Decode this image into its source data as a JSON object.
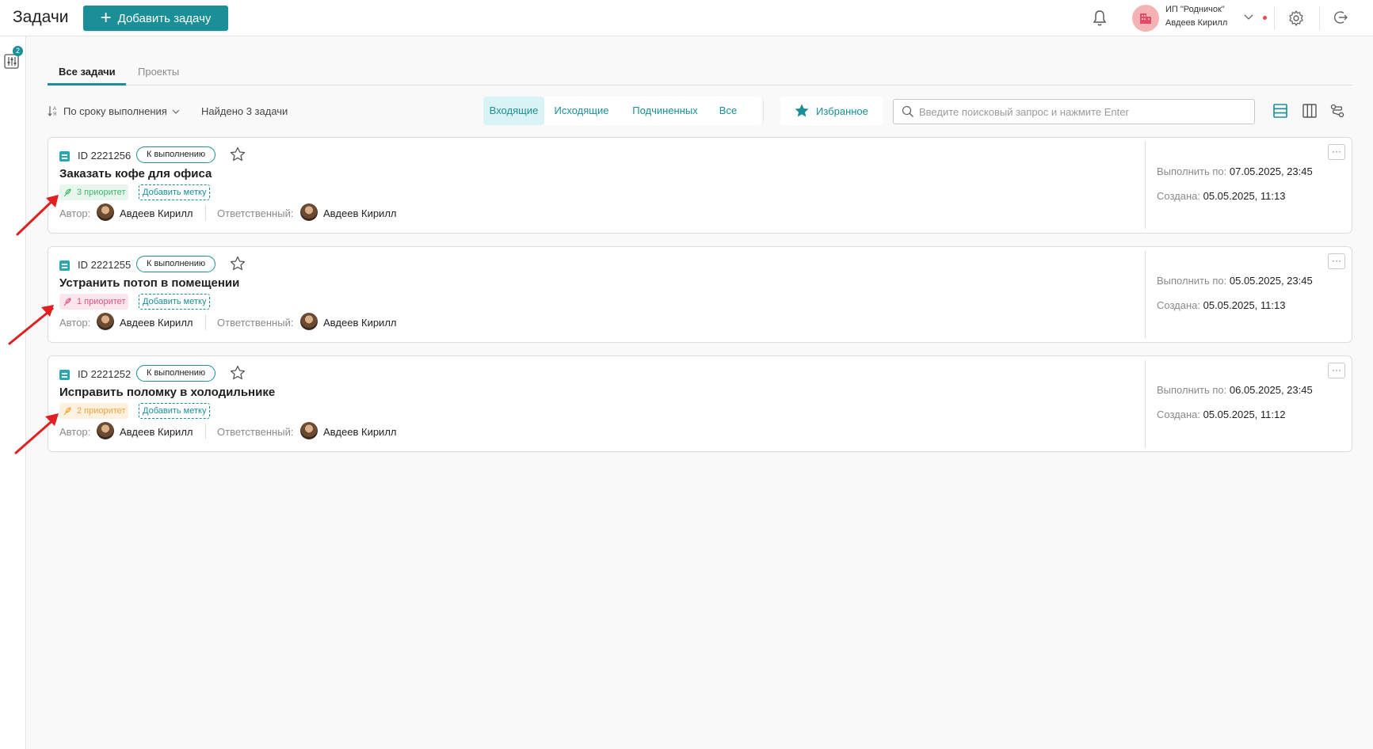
{
  "header": {
    "title": "Задачи",
    "add_task_label": "Добавить задачу",
    "company": "ИП \"Родничок\"",
    "user": "Авдеев Кирилл"
  },
  "rail": {
    "filter_badge": "2"
  },
  "tabs": [
    {
      "label": "Все задачи",
      "active": true
    },
    {
      "label": "Проекты",
      "active": false
    }
  ],
  "toolbar": {
    "sort_label": "По сроку выполнения",
    "found_label": "Найдено 3 задачи",
    "filters": [
      {
        "label": "Входящие",
        "active": true
      },
      {
        "label": "Исходящие",
        "active": false
      },
      {
        "label": "Подчиненных",
        "active": false
      },
      {
        "label": "Все",
        "active": false
      }
    ],
    "favorites_label": "Избранное",
    "search_placeholder": "Введите поисковый запрос и нажмите Enter",
    "search_value": ""
  },
  "labels": {
    "author": "Автор:",
    "assignee": "Ответственный:",
    "due": "Выполнить по:",
    "created": "Создана:",
    "add_tag": "Добавить метку",
    "menu": "···"
  },
  "colors": {
    "accent": "#1a8f97",
    "priority_1": "#e0547b",
    "priority_2": "#f0a23c",
    "priority_3": "#3fb86b"
  },
  "tasks": [
    {
      "id": "ID 2221256",
      "status": "К выполнению",
      "title": "Заказать кофе для офиса",
      "priority": "3 приоритет",
      "priority_level": 3,
      "author": "Авдеев Кирилл",
      "assignee": "Авдеев Кирилл",
      "due": "07.05.2025, 23:45",
      "created": "05.05.2025, 11:13"
    },
    {
      "id": "ID 2221255",
      "status": "К выполнению",
      "title": "Устранить потоп в помещении",
      "priority": "1 приоритет",
      "priority_level": 1,
      "author": "Авдеев Кирилл",
      "assignee": "Авдеев Кирилл",
      "due": "05.05.2025, 23:45",
      "created": "05.05.2025, 11:13"
    },
    {
      "id": "ID 2221252",
      "status": "К выполнению",
      "title": "Исправить поломку в холодильнике",
      "priority": "2 приоритет",
      "priority_level": 2,
      "author": "Авдеев Кирилл",
      "assignee": "Авдеев Кирилл",
      "due": "06.05.2025, 23:45",
      "created": "05.05.2025, 11:12"
    }
  ]
}
